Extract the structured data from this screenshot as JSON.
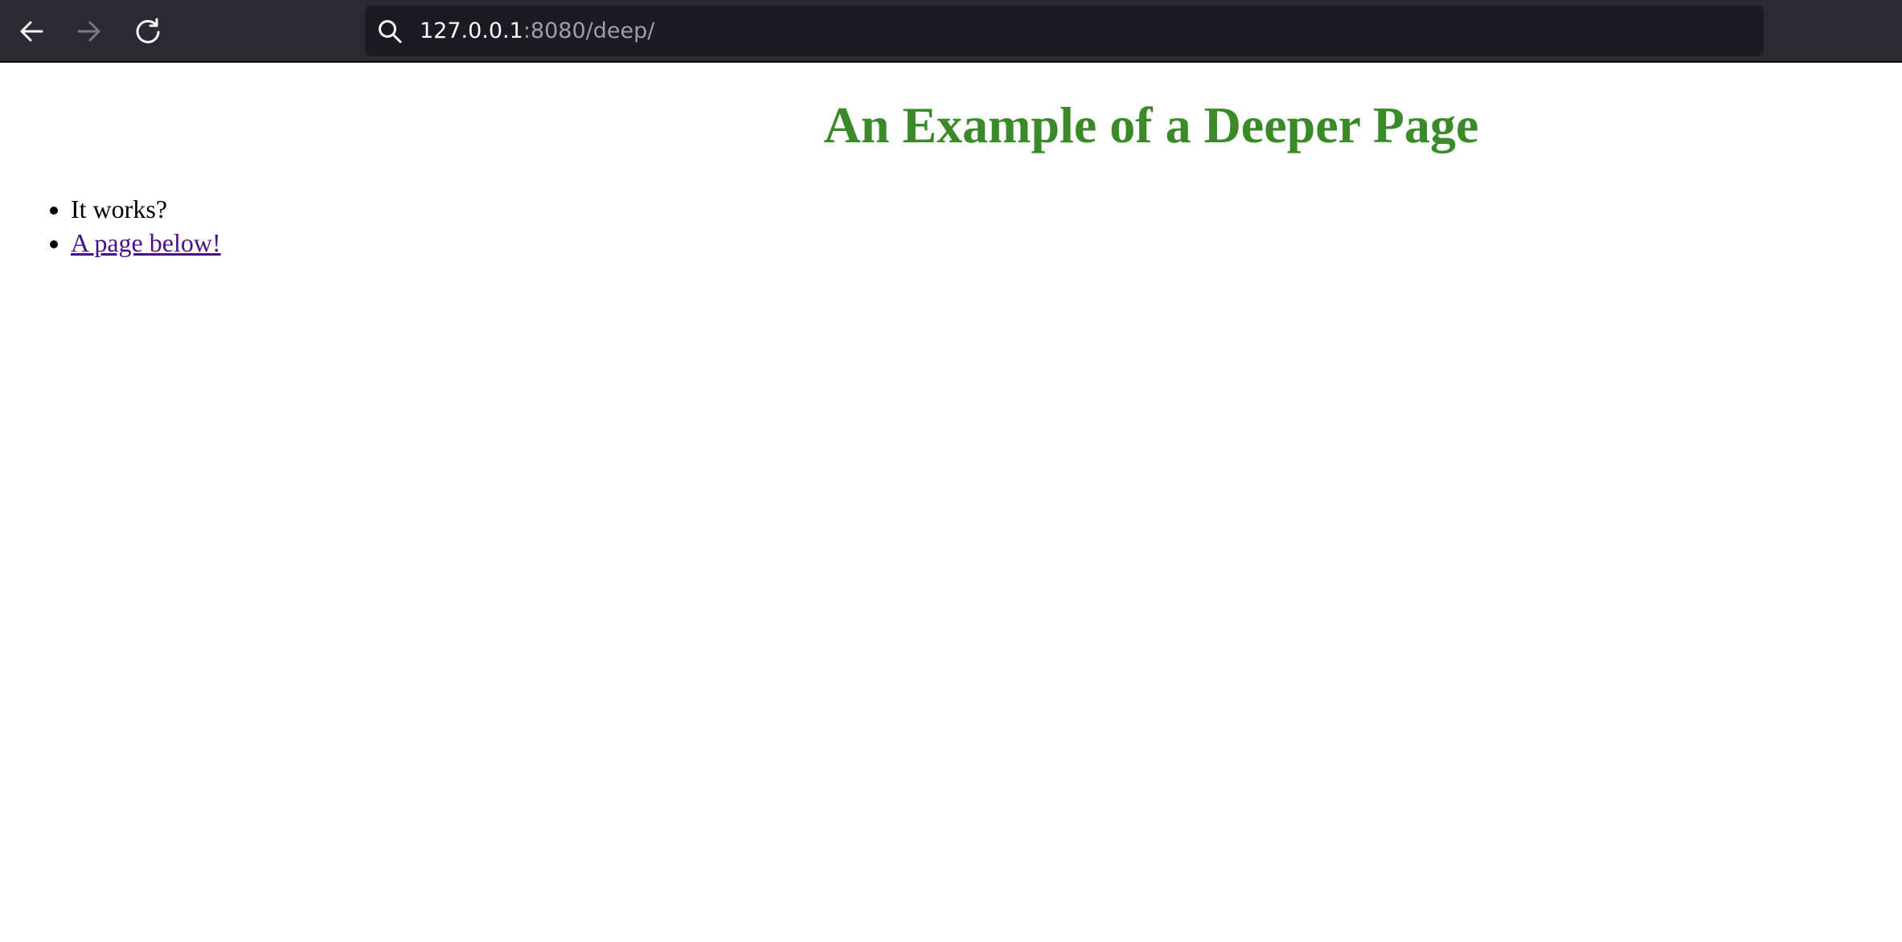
{
  "browser": {
    "url_host": "127.0.0.1",
    "url_rest": ":8080/deep/",
    "icons": {
      "back": "arrow-left-icon",
      "forward": "arrow-right-icon",
      "reload": "reload-icon",
      "search": "search-icon"
    }
  },
  "page": {
    "title": "An Example of a Deeper Page",
    "title_color": "#3a8a2a",
    "items": [
      {
        "text": "It works?"
      },
      {
        "link_text": "A page below!",
        "link_color": "#4b0f88"
      }
    ]
  }
}
